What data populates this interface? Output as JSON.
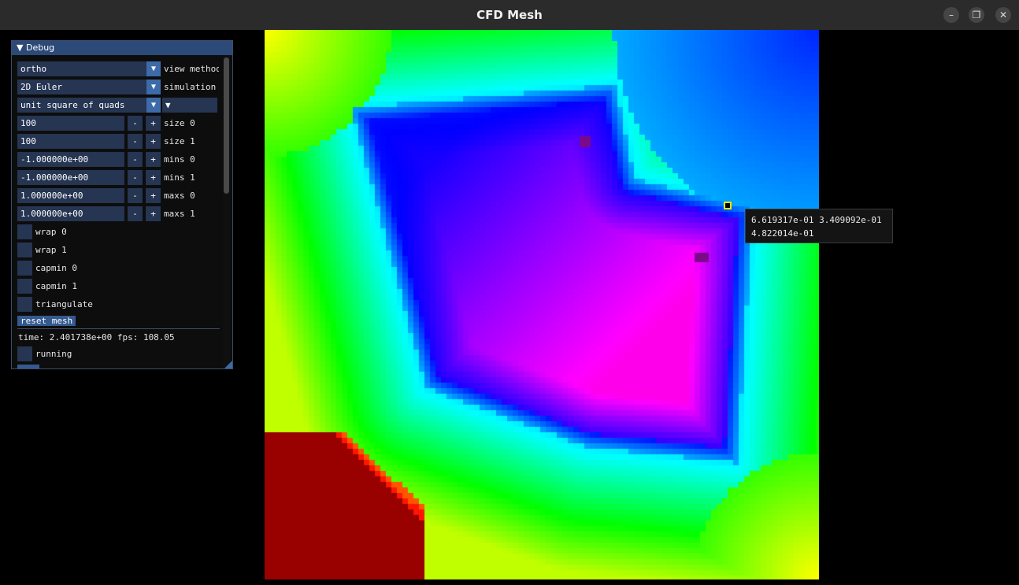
{
  "window": {
    "title": "CFD Mesh"
  },
  "debug": {
    "title": "Debug",
    "collapse_arrow": "▼",
    "view_method": {
      "value": "ortho",
      "label": "view method"
    },
    "simulation": {
      "value": "2D Euler",
      "label": "simulation"
    },
    "mesh_type": {
      "value": "unit square of quads"
    },
    "params": [
      {
        "value": "100",
        "label": "size 0"
      },
      {
        "value": "100",
        "label": "size 1"
      },
      {
        "value": "-1.000000e+00",
        "label": "mins 0"
      },
      {
        "value": "-1.000000e+00",
        "label": "mins 1"
      },
      {
        "value": "1.000000e+00",
        "label": "maxs 0"
      },
      {
        "value": "1.000000e+00",
        "label": "maxs 1"
      }
    ],
    "stepper": {
      "minus": "-",
      "plus": "+"
    },
    "checks": [
      {
        "label": "wrap 0",
        "checked": false
      },
      {
        "label": "wrap 1",
        "checked": false
      },
      {
        "label": "capmin 0",
        "checked": false
      },
      {
        "label": "capmin 1",
        "checked": false
      },
      {
        "label": "triangulate",
        "checked": false
      }
    ],
    "reset_button": "reset mesh",
    "status": "time: 2.401738e+00 fps: 108.05",
    "running": {
      "label": "running",
      "checked": false
    }
  },
  "tooltip": {
    "line1": "6.619317e-01 3.409092e-01",
    "line2": "4.822014e-01"
  },
  "colors": {
    "panel_header": "#2c4a78",
    "widget_bg": "#253552",
    "accent": "#3d6aa8",
    "marker": "#ffe600"
  }
}
